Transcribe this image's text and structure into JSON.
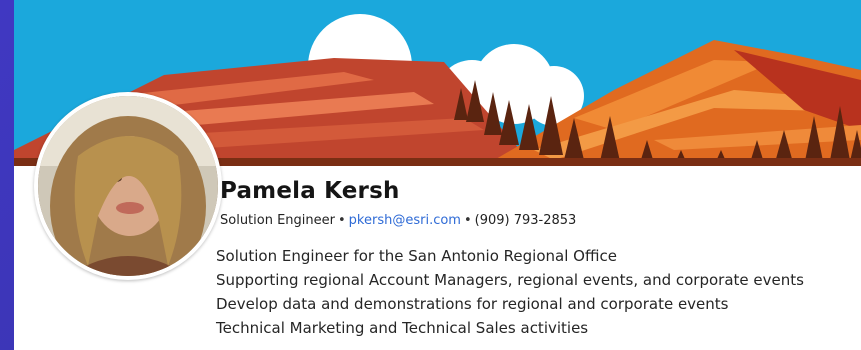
{
  "profile": {
    "name": "Pamela Kersh",
    "title": "Solution Engineer",
    "separator": "•",
    "email": "pkersh@esri.com",
    "phone": "(909) 793-2853",
    "bio_lines": [
      "Solution Engineer for the San Antonio Regional Office",
      "Supporting regional Account Managers, regional events, and corporate events",
      "Develop data and demonstrations for regional and corporate events",
      "Technical Marketing and Technical Sales activities"
    ]
  },
  "colors": {
    "sky": "#1ba8dc",
    "email_link": "#2f6bd6",
    "background": "#3b35b3"
  }
}
